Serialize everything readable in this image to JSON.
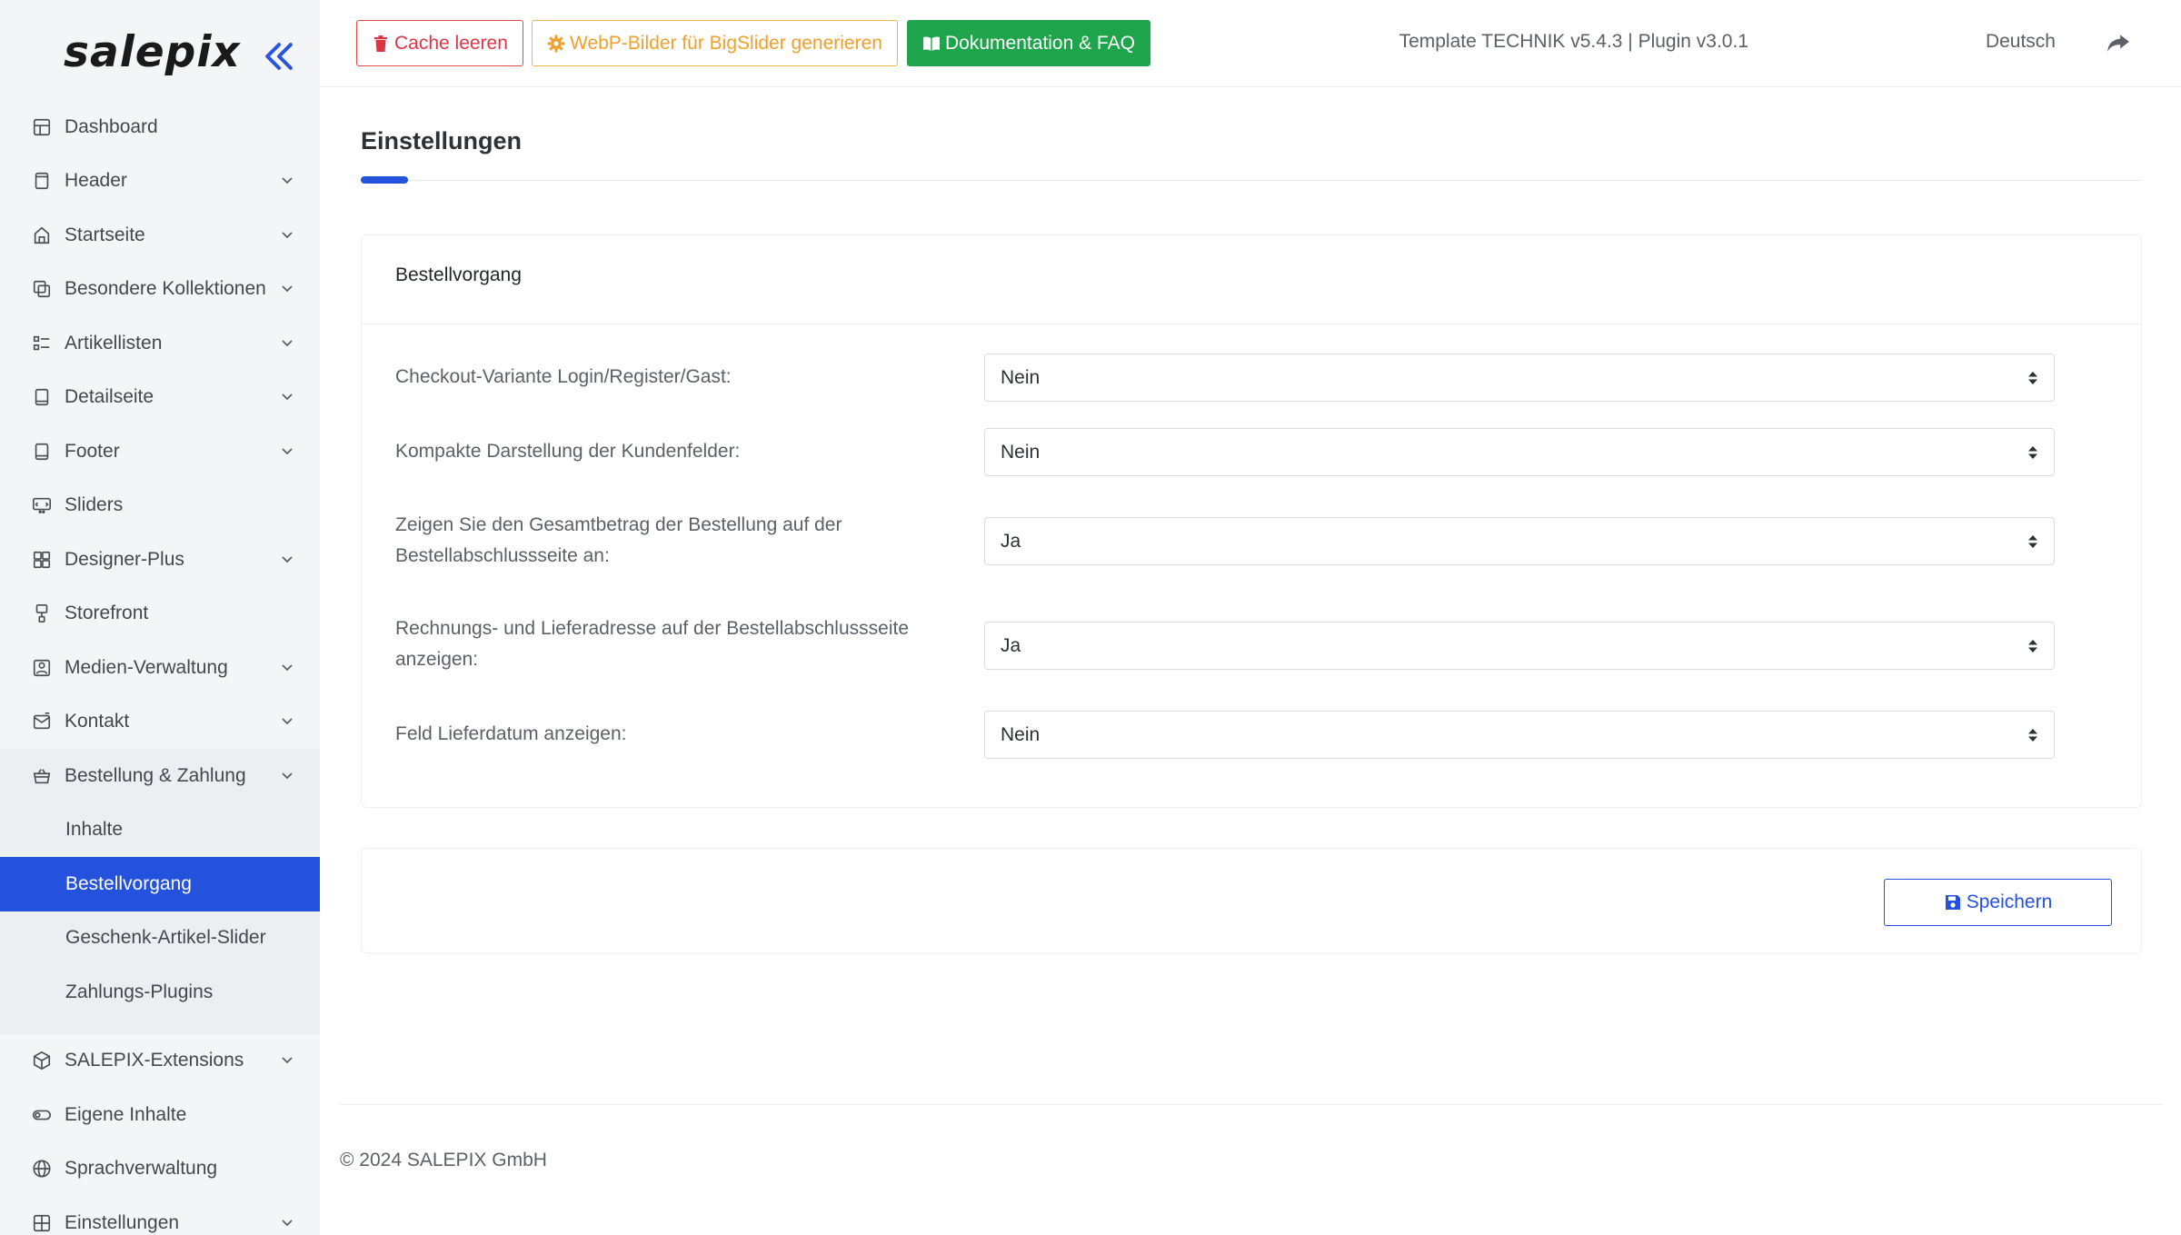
{
  "brand": {
    "logo_text": "salepix"
  },
  "sidebar": {
    "items": [
      {
        "label": "Dashboard",
        "icon": "dashboard-icon",
        "chevron": false
      },
      {
        "label": "Header",
        "icon": "header-icon",
        "chevron": true
      },
      {
        "label": "Startseite",
        "icon": "home-icon",
        "chevron": true
      },
      {
        "label": "Besondere Kollektionen",
        "icon": "collections-icon",
        "chevron": true
      },
      {
        "label": "Artikellisten",
        "icon": "list-icon",
        "chevron": true
      },
      {
        "label": "Detailseite",
        "icon": "detail-page-icon",
        "chevron": true
      },
      {
        "label": "Footer",
        "icon": "footer-icon",
        "chevron": true
      },
      {
        "label": "Sliders",
        "icon": "slider-icon",
        "chevron": false
      },
      {
        "label": "Designer-Plus",
        "icon": "designer-icon",
        "chevron": true
      },
      {
        "label": "Storefront",
        "icon": "storefront-icon",
        "chevron": false
      },
      {
        "label": "Medien-Verwaltung",
        "icon": "media-icon",
        "chevron": true
      },
      {
        "label": "Kontakt",
        "icon": "contact-icon",
        "chevron": true
      },
      {
        "label": "Bestellung & Zahlung",
        "icon": "basket-icon",
        "chevron": true,
        "open": true
      }
    ],
    "subitems": [
      {
        "label": "Inhalte",
        "active": false
      },
      {
        "label": "Bestellvorgang",
        "active": true
      },
      {
        "label": "Geschenk-Artikel-Slider",
        "active": false
      },
      {
        "label": "Zahlungs-Plugins",
        "active": false
      }
    ],
    "items_after": [
      {
        "label": "SALEPIX-Extensions",
        "icon": "extensions-icon",
        "chevron": true
      },
      {
        "label": "Eigene Inhalte",
        "icon": "toggle-icon",
        "chevron": false
      },
      {
        "label": "Sprachverwaltung",
        "icon": "globe-icon",
        "chevron": false
      },
      {
        "label": "Einstellungen",
        "icon": "settings-grid-icon",
        "chevron": true
      }
    ]
  },
  "toolbar": {
    "cache_label": "Cache leeren",
    "webp_label": "WebP-Bilder für BigSlider generieren",
    "docs_label": "Dokumentation & FAQ",
    "version": "Template TECHNIK v5.4.3 | Plugin v3.0.1",
    "language": "Deutsch"
  },
  "page": {
    "title": "Einstellungen"
  },
  "card": {
    "title": "Bestellvorgang",
    "fields": [
      {
        "label": "Checkout-Variante Login/Register/Gast:",
        "value": "Nein"
      },
      {
        "label": "Kompakte Darstellung der Kundenfelder:",
        "value": "Nein"
      },
      {
        "label": "Zeigen Sie den Gesamtbetrag der Bestellung auf der Bestellabschlussseite an:",
        "value": "Ja"
      },
      {
        "label": "Rechnungs- und Lieferadresse auf der Bestellabschlussseite anzeigen:",
        "value": "Ja"
      },
      {
        "label": "Feld Lieferdatum anzeigen:",
        "value": "Nein"
      }
    ]
  },
  "actions": {
    "save_label": "Speichern"
  },
  "footer": {
    "copyright": "© 2024 SALEPIX GmbH"
  },
  "colors": {
    "accent": "#2452dd",
    "danger": "#dc3545",
    "warning": "#f0a02b",
    "success": "#1ea44a",
    "sidebar_bg": "#f4f5f7"
  }
}
